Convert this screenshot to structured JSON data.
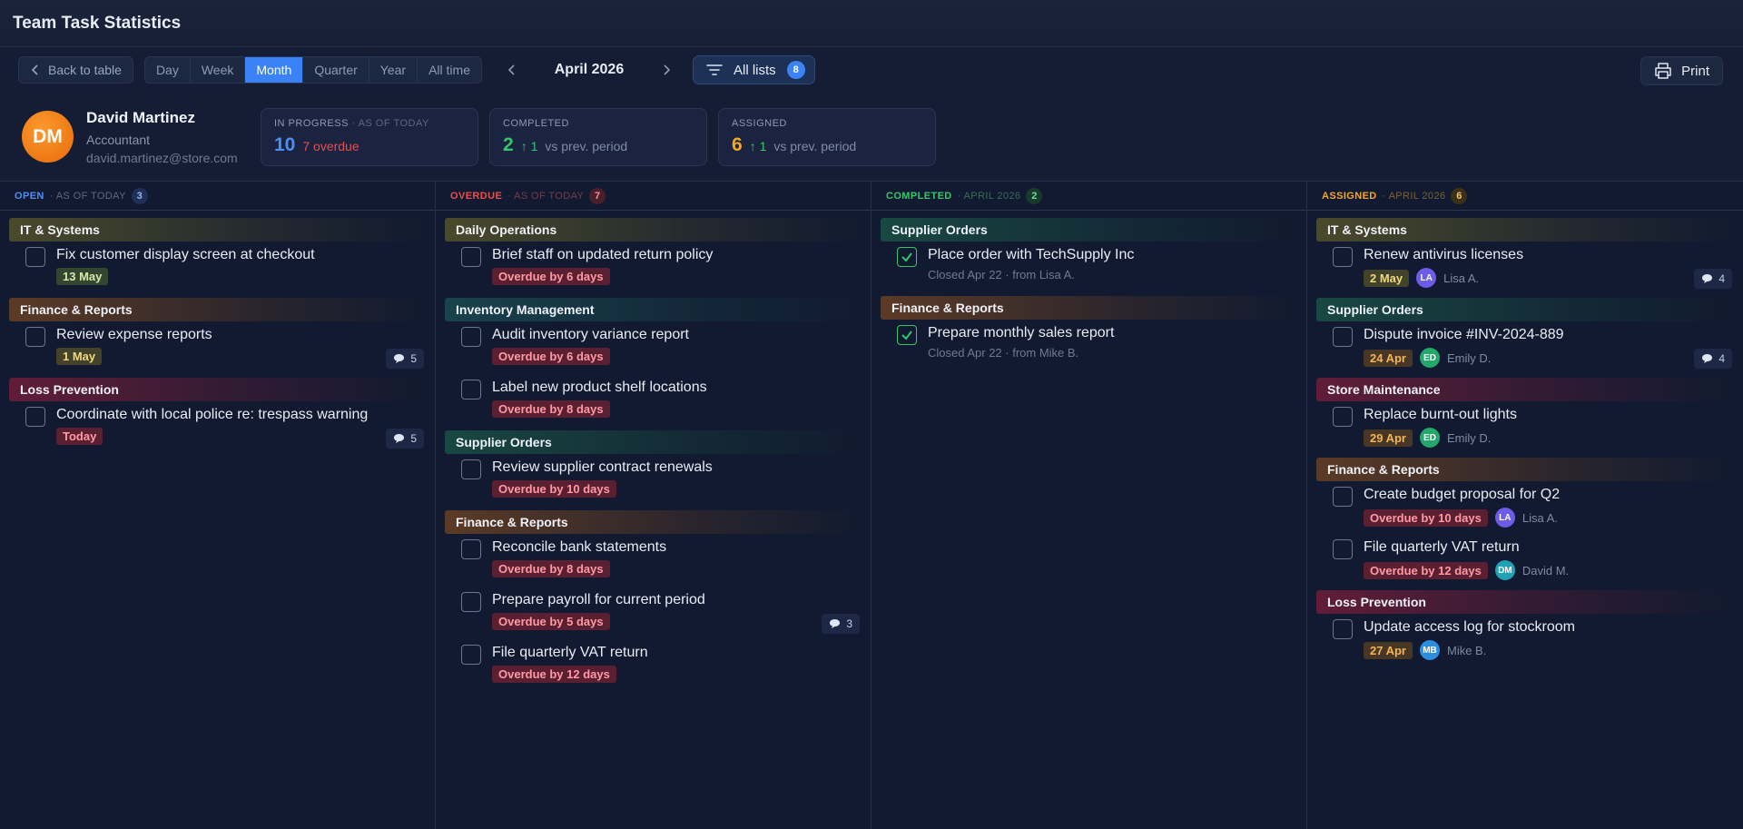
{
  "app": {
    "title": "Team Task Statistics"
  },
  "toolbar": {
    "back_label": "Back to table",
    "periods": [
      "Day",
      "Week",
      "Month",
      "Quarter",
      "Year",
      "All time"
    ],
    "active_period": "Month",
    "current_period": "April 2026",
    "filter_label": "All lists",
    "filter_count": "8",
    "print_label": "Print"
  },
  "profile": {
    "initials": "DM",
    "name": "David Martinez",
    "role": "Accountant",
    "email": "david.martinez@store.com"
  },
  "stats": {
    "in_progress": {
      "label": "IN PROGRESS",
      "sub": "· AS OF TODAY",
      "value": "10",
      "extra": "7 overdue"
    },
    "completed": {
      "label": "COMPLETED",
      "value": "2",
      "delta": "↑ 1",
      "compare": "vs prev. period"
    },
    "assigned": {
      "label": "ASSIGNED",
      "value": "6",
      "delta": "↑ 1",
      "compare": "vs prev. period"
    }
  },
  "columns": {
    "open": {
      "label": "OPEN",
      "sub": "· AS OF TODAY",
      "count": "3",
      "groups": [
        {
          "name": "IT & Systems",
          "tasks": [
            {
              "title": "Fix customer display screen at checkout",
              "date": "13 May"
            }
          ]
        },
        {
          "name": "Finance & Reports",
          "tasks": [
            {
              "title": "Review expense reports",
              "date": "1 May",
              "comments": "5"
            }
          ]
        },
        {
          "name": "Loss Prevention",
          "tasks": [
            {
              "title": "Coordinate with local police re: trespass warning",
              "date": "Today",
              "comments": "5"
            }
          ]
        }
      ]
    },
    "overdue": {
      "label": "OVERDUE",
      "sub": "· AS OF TODAY",
      "count": "7",
      "groups": [
        {
          "name": "Daily Operations",
          "tasks": [
            {
              "title": "Brief staff on updated return policy",
              "status": "Overdue by 6 days"
            }
          ]
        },
        {
          "name": "Inventory Management",
          "tasks": [
            {
              "title": "Audit inventory variance report",
              "status": "Overdue by 6 days"
            },
            {
              "title": "Label new product shelf locations",
              "status": "Overdue by 8 days"
            }
          ]
        },
        {
          "name": "Supplier Orders",
          "tasks": [
            {
              "title": "Review supplier contract renewals",
              "status": "Overdue by 10 days"
            }
          ]
        },
        {
          "name": "Finance & Reports",
          "tasks": [
            {
              "title": "Reconcile bank statements",
              "status": "Overdue by 8 days"
            },
            {
              "title": "Prepare payroll for current period",
              "status": "Overdue by 5 days",
              "comments": "3"
            },
            {
              "title": "File quarterly VAT return",
              "status": "Overdue by 12 days"
            }
          ]
        }
      ]
    },
    "completed": {
      "label": "COMPLETED",
      "sub": "· APRIL 2026",
      "count": "2",
      "groups": [
        {
          "name": "Supplier Orders",
          "tasks": [
            {
              "title": "Place order with TechSupply Inc",
              "closed": "Closed Apr 22 · from Lisa A."
            }
          ]
        },
        {
          "name": "Finance & Reports",
          "tasks": [
            {
              "title": "Prepare monthly sales report",
              "closed": "Closed Apr 22 · from Mike B."
            }
          ]
        }
      ]
    },
    "assigned": {
      "label": "ASSIGNED",
      "sub": "· APRIL 2026",
      "count": "6",
      "groups": [
        {
          "name": "IT & Systems",
          "tasks": [
            {
              "title": "Renew antivirus licenses",
              "date": "2 May",
              "initials": "LA",
              "assignee": "Lisa A.",
              "comments": "4"
            }
          ]
        },
        {
          "name": "Supplier Orders",
          "tasks": [
            {
              "title": "Dispute invoice #INV-2024-889",
              "date": "24 Apr",
              "initials": "ED",
              "assignee": "Emily D.",
              "comments": "4"
            }
          ]
        },
        {
          "name": "Store Maintenance",
          "tasks": [
            {
              "title": "Replace burnt-out lights",
              "date": "29 Apr",
              "initials": "ED",
              "assignee": "Emily D."
            }
          ]
        },
        {
          "name": "Finance & Reports",
          "tasks": [
            {
              "title": "Create budget proposal for Q2",
              "status": "Overdue by 10 days",
              "initials": "LA",
              "assignee": "Lisa A."
            },
            {
              "title": "File quarterly VAT return",
              "status": "Overdue by 12 days",
              "initials": "DM",
              "assignee": "David M."
            }
          ]
        },
        {
          "name": "Loss Prevention",
          "tasks": [
            {
              "title": "Update access log for stockroom",
              "date": "27 Apr",
              "initials": "MB",
              "assignee": "Mike B."
            }
          ]
        }
      ]
    }
  },
  "colors": {
    "accent": "#3b82f6",
    "open": "#4e8ef7",
    "overdue": "#ef4b4b",
    "completed": "#34c76a",
    "assigned": "#f5a623"
  },
  "icons": {
    "back": "chevron-left-icon",
    "prev": "chevron-left-icon",
    "next": "chevron-right-icon",
    "filter": "filter-icon",
    "print": "printer-icon",
    "comment": "comment-icon",
    "check": "check-icon"
  }
}
